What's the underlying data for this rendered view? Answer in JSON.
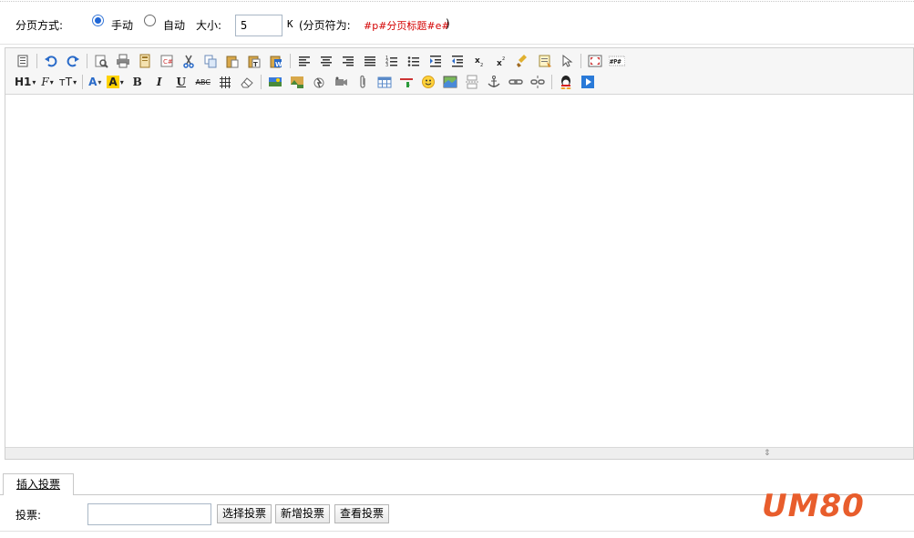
{
  "paging": {
    "label": "分页方式:",
    "manual_label": "手动",
    "auto_label": "自动",
    "mode": "manual",
    "size_label": "大小:",
    "size_value": "5",
    "size_unit": "K",
    "separator_prefix": "(分页符为:",
    "separator_code": "#p#分页标题#e#",
    "separator_suffix": ")"
  },
  "editor": {
    "toolbar_row1": [
      "source-icon",
      "undo-icon",
      "redo-icon",
      "preview-icon",
      "print-icon",
      "template-icon",
      "code-icon",
      "cut-icon",
      "copy-icon",
      "paste-icon",
      "paste-text-icon",
      "paste-word-icon",
      "align-left-icon",
      "align-center-icon",
      "align-right-icon",
      "align-justify-icon",
      "ordered-list-icon",
      "unordered-list-icon",
      "indent-icon",
      "outdent-icon",
      "subscript-icon",
      "superscript-icon",
      "clear-format-icon",
      "select-all-icon",
      "pointer-icon",
      "fullscreen-icon",
      "page-break-icon"
    ],
    "toolbar_row2_text": {
      "heading": "H1",
      "font_family": "F",
      "font_size": "тT",
      "font_color": "A",
      "highlight": "A",
      "bold": "B",
      "italic": "I",
      "underline": "U",
      "strike": "ABC"
    },
    "toolbar_row2_icons": [
      "line-height-icon",
      "eraser-icon",
      "image-icon",
      "multi-image-icon",
      "flash-icon",
      "media-icon",
      "attachment-icon",
      "table-icon",
      "hr-icon",
      "emoticon-icon",
      "map-icon",
      "pagebreak-icon",
      "anchor-icon",
      "link-icon",
      "unlink-icon",
      "qq-icon",
      "video-icon"
    ],
    "page_break_label": "#P#",
    "content": ""
  },
  "vote": {
    "tab_label": "插入投票",
    "field_label": "投票:",
    "field_value": "",
    "select_button": "选择投票",
    "new_button": "新增投票",
    "view_button": "查看投票"
  },
  "watermark": {
    "text": "UM80",
    "color": "#e85d2c"
  }
}
